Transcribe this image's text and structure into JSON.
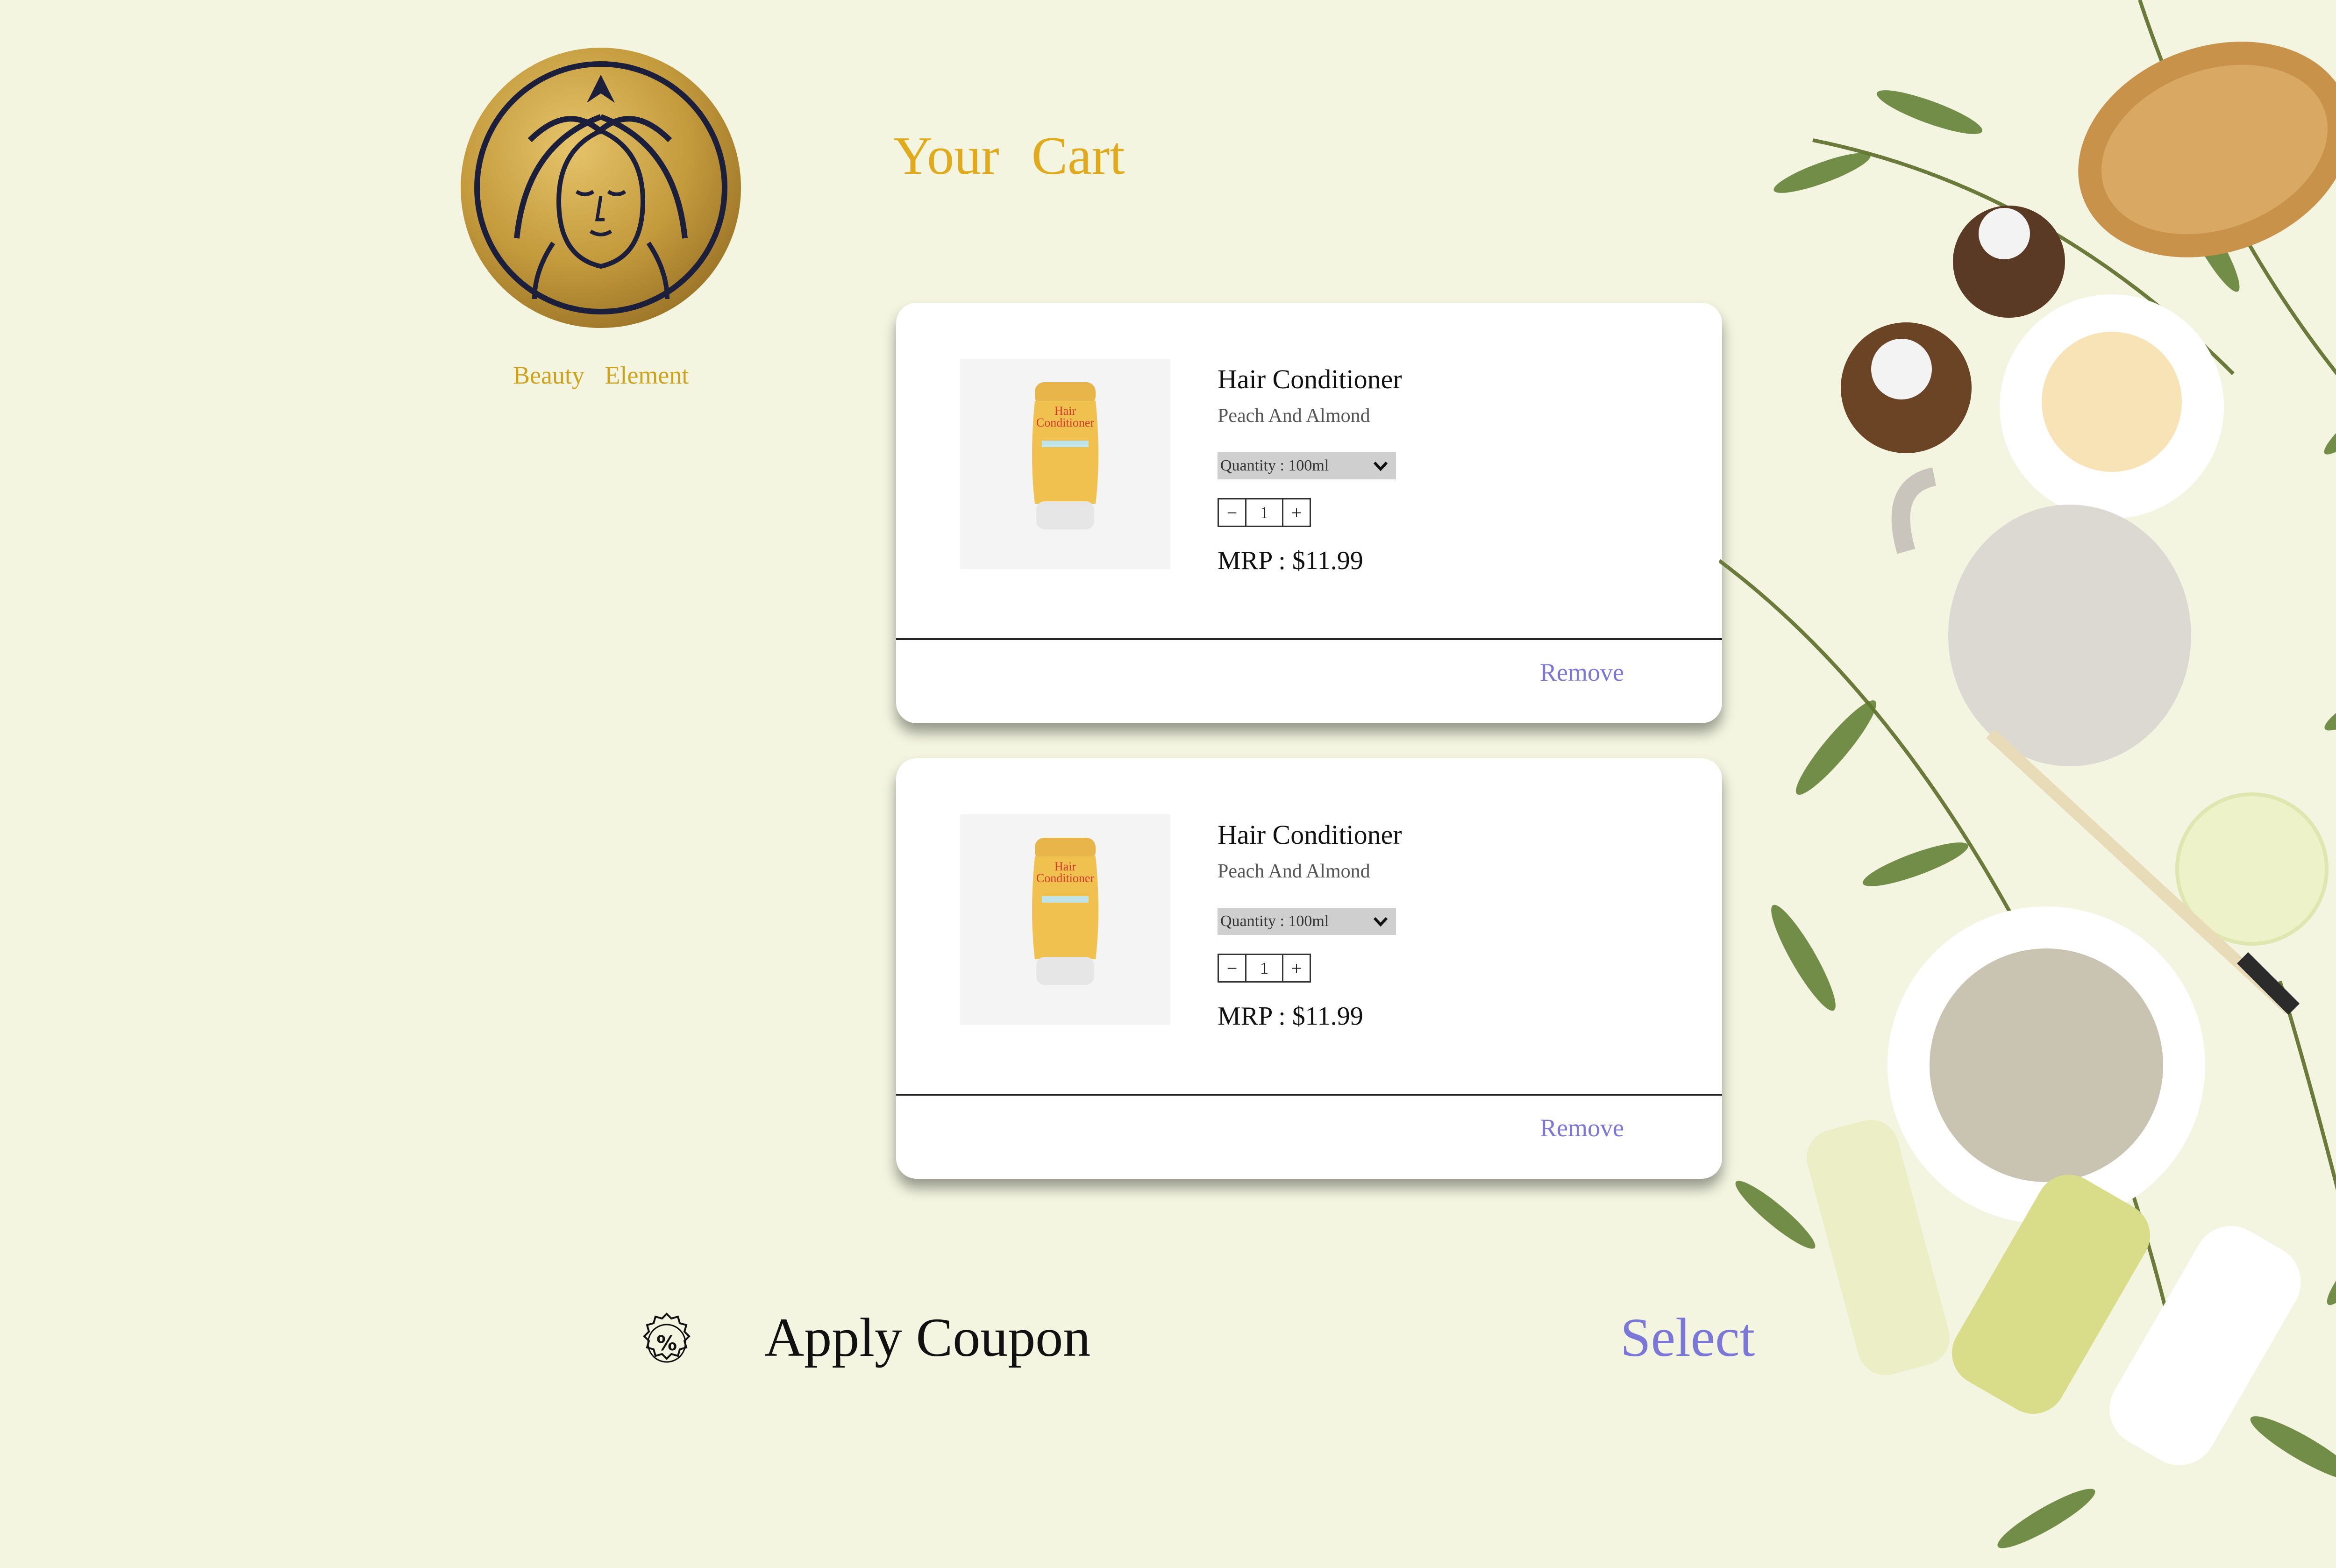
{
  "brand": {
    "logo": "beauty-element-logo",
    "name": "Beauty   Element"
  },
  "page": {
    "title": "Your  Cart"
  },
  "cart": {
    "items": [
      {
        "image": "hair-conditioner-bottle",
        "name": "Hair Conditioner",
        "variant": "Peach And Almond",
        "quantity_option": "Quantity : 100ml",
        "count": "1",
        "minus": "−",
        "plus": "+",
        "price": "MRP : $11.99",
        "remove_label": "Remove"
      },
      {
        "image": "hair-conditioner-bottle",
        "name": "Hair Conditioner",
        "variant": "Peach And Almond",
        "quantity_option": "Quantity : 100ml",
        "count": "1",
        "minus": "−",
        "plus": "+",
        "price": "MRP : $11.99",
        "remove_label": "Remove"
      }
    ]
  },
  "coupon": {
    "icon": "percent-badge-icon",
    "label": "Apply Coupon",
    "action": "Select"
  },
  "colors": {
    "background": "#f3f5e0",
    "gold": "#e0aa1c",
    "accent": "#7b77d8"
  }
}
